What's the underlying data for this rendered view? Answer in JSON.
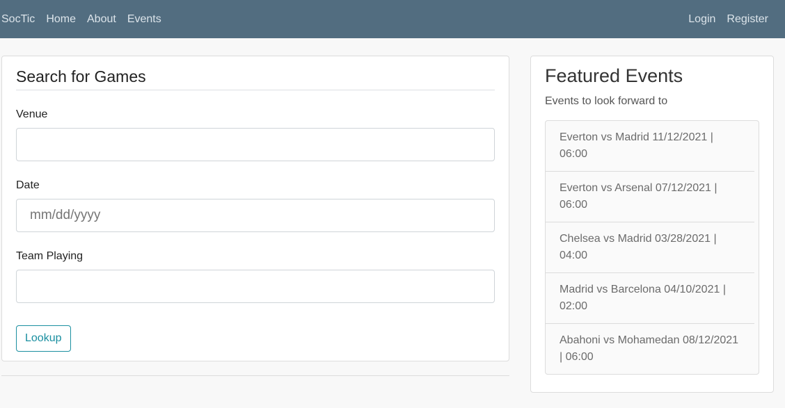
{
  "nav": {
    "brand": "SocTic",
    "links": [
      "Home",
      "About",
      "Events"
    ],
    "right": [
      "Login",
      "Register"
    ]
  },
  "search": {
    "title": "Search for Games",
    "venue_label": "Venue",
    "venue_value": "",
    "date_label": "Date",
    "date_placeholder": "mm/dd/yyyy",
    "team_label": "Team Playing",
    "team_value": "",
    "button": "Lookup"
  },
  "featured": {
    "title": "Featured Events",
    "subtitle": "Events to look forward to",
    "events": [
      "Everton vs Madrid 11/12/2021 | 06:00",
      "Everton vs Arsenal 07/12/2021 | 06:00",
      "Chelsea vs Madrid 03/28/2021 | 04:00",
      "Madrid vs Barcelona 04/10/2021 | 02:00",
      "Abahoni vs Mohamedan 08/12/2021 | 06:00"
    ]
  }
}
